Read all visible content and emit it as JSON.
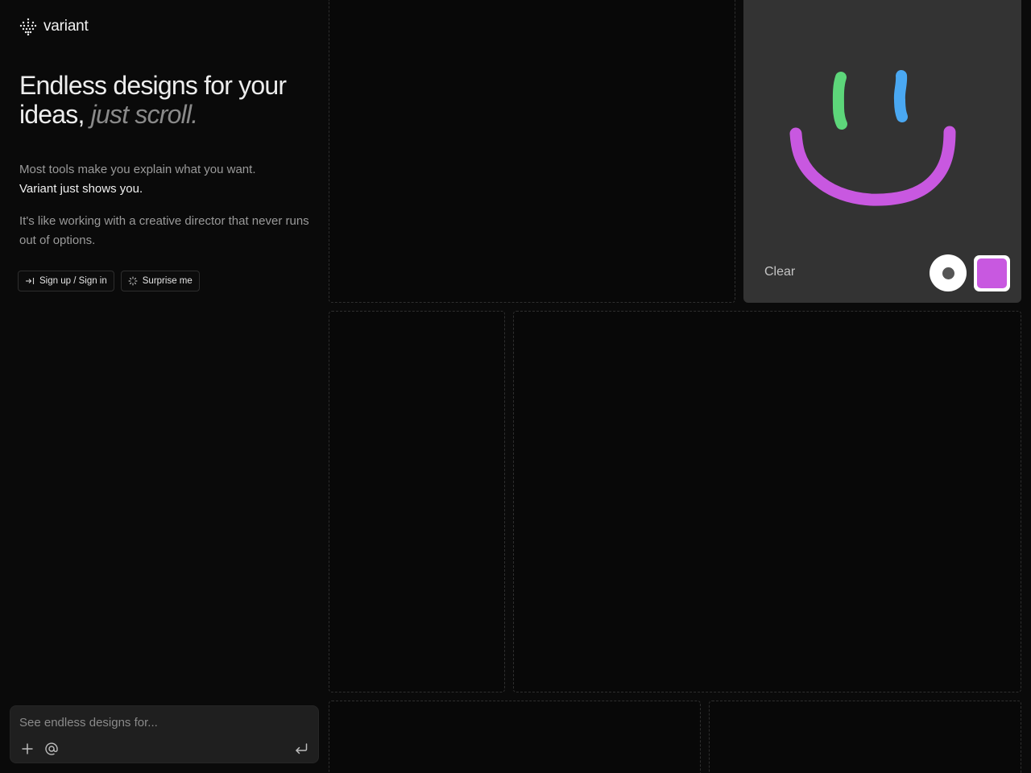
{
  "brand": {
    "name": "variant",
    "logo_icon": "dotted-grid-logo-icon"
  },
  "hero": {
    "headline_main": "Endless designs for your ideas,",
    "headline_accent": "just scroll."
  },
  "copy": {
    "p1_text": "Most tools make you explain what you want.",
    "p1_emphasis": "Variant just shows you.",
    "p2_text": "It's like working with a creative director that never runs out of options."
  },
  "actions": {
    "signup_label": "Sign up / Sign in",
    "signup_icon": "sign-in-arrow-icon",
    "surprise_label": "Surprise me",
    "surprise_icon": "sparkle-icon"
  },
  "prompt": {
    "placeholder": "See endless designs for...",
    "value": "",
    "add_icon": "plus-icon",
    "mention_icon": "at-icon",
    "submit_icon": "enter-icon"
  },
  "drawing_pad": {
    "clear_label": "Clear",
    "brush_icon": "brush-size-icon",
    "selected_color": "#c858e0",
    "stroke_colors": {
      "left_eye": "#5dd67a",
      "right_eye": "#4aa8f2",
      "mouth": "#c858e0"
    }
  },
  "colors": {
    "background": "#0a0a0a",
    "card": "#333333",
    "tile_border": "#2f2f2f"
  }
}
